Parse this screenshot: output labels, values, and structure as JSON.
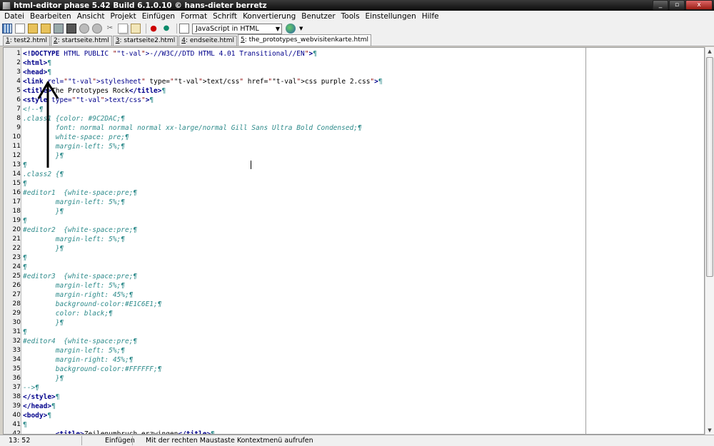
{
  "window": {
    "title": "html-editor phase 5.42 Build 6.1.0.10  ©  hans-dieter berretz",
    "controls": [
      "_",
      "▫",
      "x"
    ]
  },
  "menu": [
    "Datei",
    "Bearbeiten",
    "Ansicht",
    "Projekt",
    "Einfügen",
    "Format",
    "Schrift",
    "Konvertierung",
    "Benutzer",
    "Tools",
    "Einstellungen",
    "Hilfe"
  ],
  "toolbar": {
    "icons": [
      "grid-icon",
      "new-document-icon",
      "open-folder-icon",
      "open-file-icon",
      "save-icon",
      "save-all-icon",
      "undo-icon",
      "redo-icon",
      "cut-icon",
      "copy-icon",
      "paste-icon",
      "record-macro-icon",
      "play-macro-icon",
      "browser-preview-icon",
      "globe-icon"
    ],
    "language_select": "JavaScript in HTML"
  },
  "tabs": [
    {
      "num": "1",
      "label": ": test2.html",
      "active": false
    },
    {
      "num": "2",
      "label": ": startseite.html",
      "active": false
    },
    {
      "num": "3",
      "label": ": startseite2.html",
      "active": false
    },
    {
      "num": "4",
      "label": ": endseite.html",
      "active": false
    },
    {
      "num": "5",
      "label": ": the_prototypes_webvisitenkarte.html",
      "active": true
    }
  ],
  "code_lines": [
    "<!DOCTYPE HTML PUBLIC \"-//W3C//DTD HTML 4.01 Transitional//EN\">¶",
    "<html>¶",
    "<head>¶",
    "<link rel=\"stylesheet\" type=\"text/css\" href=\"css purple 2.css\">¶",
    "<title>The Prototypes Rock</title>¶",
    "<style type=\"text/css\">¶",
    "<!--¶",
    ".class1 {color: #9C2DAC;¶",
    "        font: normal normal normal xx-large/normal Gill Sans Ultra Bold Condensed;¶",
    "        white-space: pre;¶",
    "        margin-left: 5%;¶",
    "        }¶",
    "¶",
    ".class2 {¶",
    "¶",
    "#editor1  {white-space:pre;¶",
    "        margin-left: 5%;¶",
    "        }¶",
    "¶",
    "#editor2  {white-space:pre;¶",
    "        margin-left: 5%;¶",
    "        }¶",
    "¶",
    "¶",
    "#editor3  {white-space:pre;¶",
    "        margin-left: 5%;¶",
    "        margin-right: 45%;¶",
    "        background-color:#E1C6E1;¶",
    "        color: black;¶",
    "        }¶",
    "¶",
    "#editor4  {white-space:pre;¶",
    "        margin-left: 5%;¶",
    "        margin-right: 45%;¶",
    "        background-color:#FFFFFF;¶",
    "        }¶",
    "-->¶",
    "</style>¶",
    "</head>¶",
    "<body>¶",
    "¶",
    "        <title>Zeilenumbruch erzwingen</title>¶"
  ],
  "status": {
    "position": "13: 52",
    "mode": "Einfügen",
    "message": "Mit der rechten Maustaste Kontextmenü aufrufen"
  }
}
